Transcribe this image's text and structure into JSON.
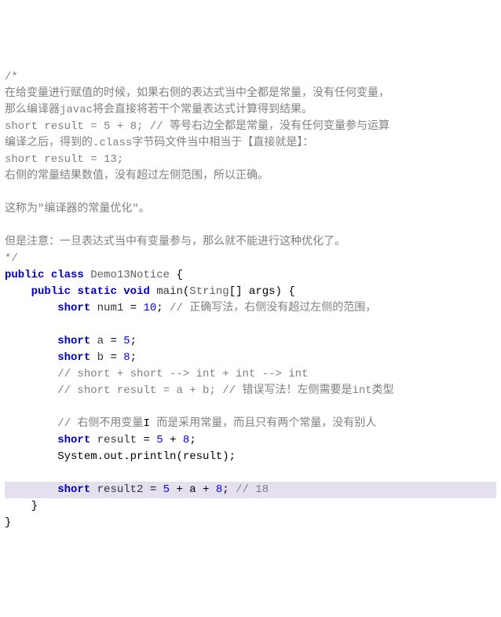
{
  "code": {
    "l1": "/*",
    "l2": "在给变量进行赋值的时候，如果右侧的表达式当中全都是常量，没有任何变量，",
    "l3": "那么编译器javac将会直接将若干个常量表达式计算得到结果。",
    "l4": "short result = 5 + 8; // 等号右边全都是常量，没有任何变量参与运算",
    "l5": "编译之后，得到的.class字节码文件当中相当于【直接就是】：",
    "l6": "short result = 13;",
    "l7": "右侧的常量结果数值，没有超过左侧范围，所以正确。",
    "l8": "",
    "l9": "这称为\"编译器的常量优化\"。",
    "l10": "",
    "l11": "但是注意：一旦表达式当中有变量参与，那么就不能进行这种优化了。",
    "l12": "*/",
    "kw_public": "public",
    "kw_class": "class",
    "cls_name": "Demo13Notice",
    "brace_open": " {",
    "kw_static": "static",
    "kw_void": "void",
    "method_main": "main",
    "str_type": "String",
    "args_part": "[] args) {",
    "kw_short": "short",
    "num1_ident": "num1",
    "eq": " = ",
    "n10": "10",
    "semi": ";",
    "c_num1": " // 正确写法，右侧没有超过左侧的范围，",
    "a_ident": "a",
    "n5": "5",
    "b_ident": "b",
    "n8": "8",
    "c_short1": "// short + short --> int + int --> int",
    "c_short2": "// short result = a + b; // 错误写法！左侧需要是int类型",
    "c_right": "// 右侧不用变量",
    "c_right2": " 而是采用常量，而且只有两个常量，没有别人",
    "result_ident": "result",
    "plus": " + ",
    "sys_out": "System.out.println(result);",
    "result2_ident": "result2",
    "plus_a": " + a + ",
    "c_18": " // 18",
    "brace_close": "}",
    "paren_open": "("
  }
}
